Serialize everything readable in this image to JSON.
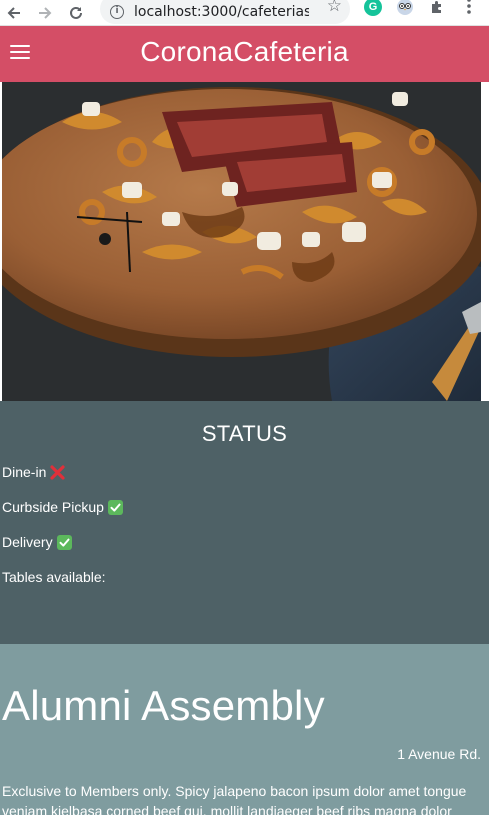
{
  "browser": {
    "url": "localhost:3000/cafeterias/...",
    "back_icon": "arrow-left-icon",
    "forward_icon": "arrow-right-icon",
    "reload_icon": "reload-icon",
    "info_icon": "info-icon",
    "bookmark_icon": "star-icon",
    "extensions": [
      "grammarly-icon",
      "owl-extension-icon",
      "puzzle-icon",
      "kebab-menu-icon"
    ]
  },
  "appbar": {
    "title": "CoronaCafeteria",
    "menu_icon": "hamburger-menu-icon",
    "color": "#d44e66"
  },
  "hero": {
    "icon": "food-photo-poutine-steak"
  },
  "status": {
    "title": "STATUS",
    "items": [
      {
        "label": "Dine-in",
        "state": "unavailable",
        "icon": "cross-mark-icon"
      },
      {
        "label": "Curbside Pickup",
        "state": "available",
        "icon": "check-mark-icon"
      },
      {
        "label": "Delivery",
        "state": "available",
        "icon": "check-mark-icon"
      }
    ],
    "tables_label": "Tables available:",
    "background": "#4e6166"
  },
  "cafeteria": {
    "name": "Alumni Assembly",
    "address": "1 Avenue Rd.",
    "description": "Exclusive to Members only. Spicy jalapeno bacon ipsum dolor amet tongue veniam kielbasa corned beef qui, mollit landjaeger beef ribs magna dolor",
    "background": "#7f9c9f"
  }
}
